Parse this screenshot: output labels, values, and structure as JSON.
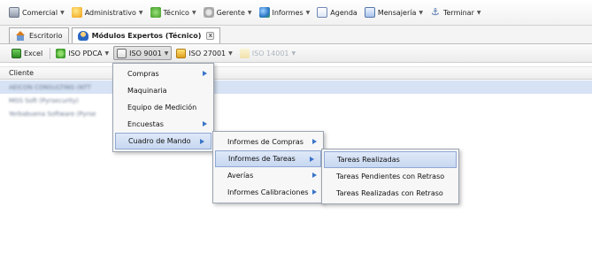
{
  "menubar": {
    "items": [
      {
        "label": "Comercial",
        "icon": "chart-icon",
        "has_dropdown": true
      },
      {
        "label": "Administrativo",
        "icon": "coins-icon",
        "has_dropdown": true
      },
      {
        "label": "Técnico",
        "icon": "wrench-icon",
        "has_dropdown": true
      },
      {
        "label": "Gerente",
        "icon": "gear-icon",
        "has_dropdown": true
      },
      {
        "label": "Informes",
        "icon": "globe-icon",
        "has_dropdown": true
      },
      {
        "label": "Agenda",
        "icon": "calendar-icon",
        "has_dropdown": false
      },
      {
        "label": "Mensajería",
        "icon": "envelope-icon",
        "has_dropdown": true
      },
      {
        "label": "Terminar",
        "icon": "anchor-icon",
        "has_dropdown": true
      }
    ]
  },
  "tabs": [
    {
      "label": "Escritorio",
      "icon": "home-icon",
      "active": false
    },
    {
      "label": "Módulos Expertos (Técnico)",
      "icon": "expert-icon",
      "active": true,
      "close_glyph": "x"
    }
  ],
  "toolbar": {
    "items": [
      {
        "label": "Excel",
        "icon": "excel-icon",
        "has_dropdown": false
      },
      {
        "label": "ISO PDCA",
        "icon": "cycle-icon",
        "has_dropdown": true
      },
      {
        "label": "ISO 9001",
        "icon": "org-chart-icon",
        "has_dropdown": true,
        "pressed": true
      },
      {
        "label": "ISO 27001",
        "icon": "lock-icon",
        "has_dropdown": true
      },
      {
        "label": "ISO 14001",
        "icon": "leaf-icon",
        "has_dropdown": true,
        "disabled": true
      }
    ]
  },
  "grid": {
    "column_header": "Cliente",
    "rows": [
      {
        "text": "AEICON CONSULTING (NTT",
        "selected": true
      },
      {
        "text": "MGS Soft (Pyrsecurity)",
        "selected": false
      },
      {
        "text": "Yerbabuena Software (Pyrse",
        "selected": false
      }
    ]
  },
  "menus": {
    "iso9001": [
      {
        "label": "Compras",
        "submenu": true
      },
      {
        "label": "Maquinaria",
        "submenu": false
      },
      {
        "label": "Equipo de Medición",
        "submenu": false
      },
      {
        "label": "Encuestas",
        "submenu": true
      },
      {
        "label": "Cuadro de Mando",
        "submenu": true,
        "highlighted": true
      }
    ],
    "cuadro_de_mando": [
      {
        "label": "Informes de Compras",
        "submenu": true
      },
      {
        "label": "Informes de Tareas",
        "submenu": true,
        "highlighted": true
      },
      {
        "label": "Averías",
        "submenu": true
      },
      {
        "label": "Informes Calibraciones",
        "submenu": true
      }
    ],
    "informes_de_tareas": [
      {
        "label": "Tareas Realizadas",
        "submenu": false,
        "highlighted": true
      },
      {
        "label": "Tareas Pendientes con Retraso",
        "submenu": false
      },
      {
        "label": "Tareas Realizadas con Retraso",
        "submenu": false
      }
    ]
  },
  "colors": {
    "highlight_bg": "#c7d8f1",
    "selected_row_bg": "#d7e3f4",
    "submenu_arrow": "#3a74c9"
  }
}
